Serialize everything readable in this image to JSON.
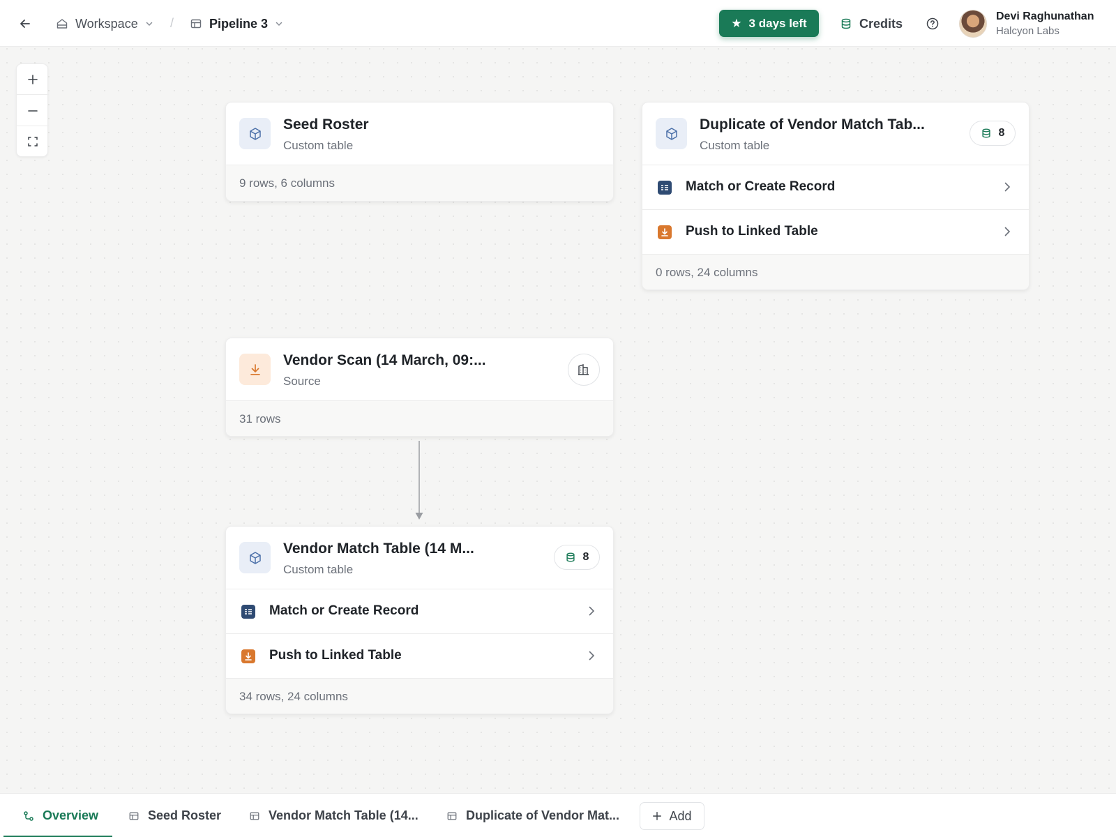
{
  "header": {
    "workspace_label": "Workspace",
    "separator": "/",
    "pipeline_label": "Pipeline 3",
    "trial_label": "3 days left",
    "credits_label": "Credits",
    "user": {
      "name": "Devi Raghunathan",
      "org": "Halcyon Labs"
    }
  },
  "nodes": {
    "seed": {
      "title": "Seed Roster",
      "subtitle": "Custom table",
      "footer": "9 rows, 6 columns"
    },
    "duplicate": {
      "title": "Duplicate of Vendor Match Tab...",
      "subtitle": "Custom table",
      "count": "8",
      "actions": [
        {
          "label": "Match or Create Record"
        },
        {
          "label": "Push to Linked Table"
        }
      ],
      "footer": "0 rows, 24 columns"
    },
    "scan": {
      "title": "Vendor Scan (14 March, 09:...",
      "subtitle": "Source",
      "footer": "31 rows"
    },
    "match": {
      "title": "Vendor Match Table (14 M...",
      "subtitle": "Custom table",
      "count": "8",
      "actions": [
        {
          "label": "Match or Create Record"
        },
        {
          "label": "Push to Linked Table"
        }
      ],
      "footer": "34 rows, 24 columns"
    }
  },
  "tabs": [
    {
      "label": "Overview",
      "active": true
    },
    {
      "label": "Seed Roster"
    },
    {
      "label": "Vendor Match Table (14..."
    },
    {
      "label": "Duplicate of Vendor Mat..."
    }
  ],
  "add_label": "Add",
  "colors": {
    "accent": "#1a7a57",
    "navy": "#2f4b73",
    "amber": "#d9782e"
  },
  "icons": {
    "back": "arrow-left-icon",
    "workspace": "workspace-icon",
    "pipeline": "table-icon",
    "credits": "database-icon",
    "help": "help-circle-icon",
    "node_table": "cube-icon",
    "node_source": "download-icon",
    "company": "building-icon"
  }
}
